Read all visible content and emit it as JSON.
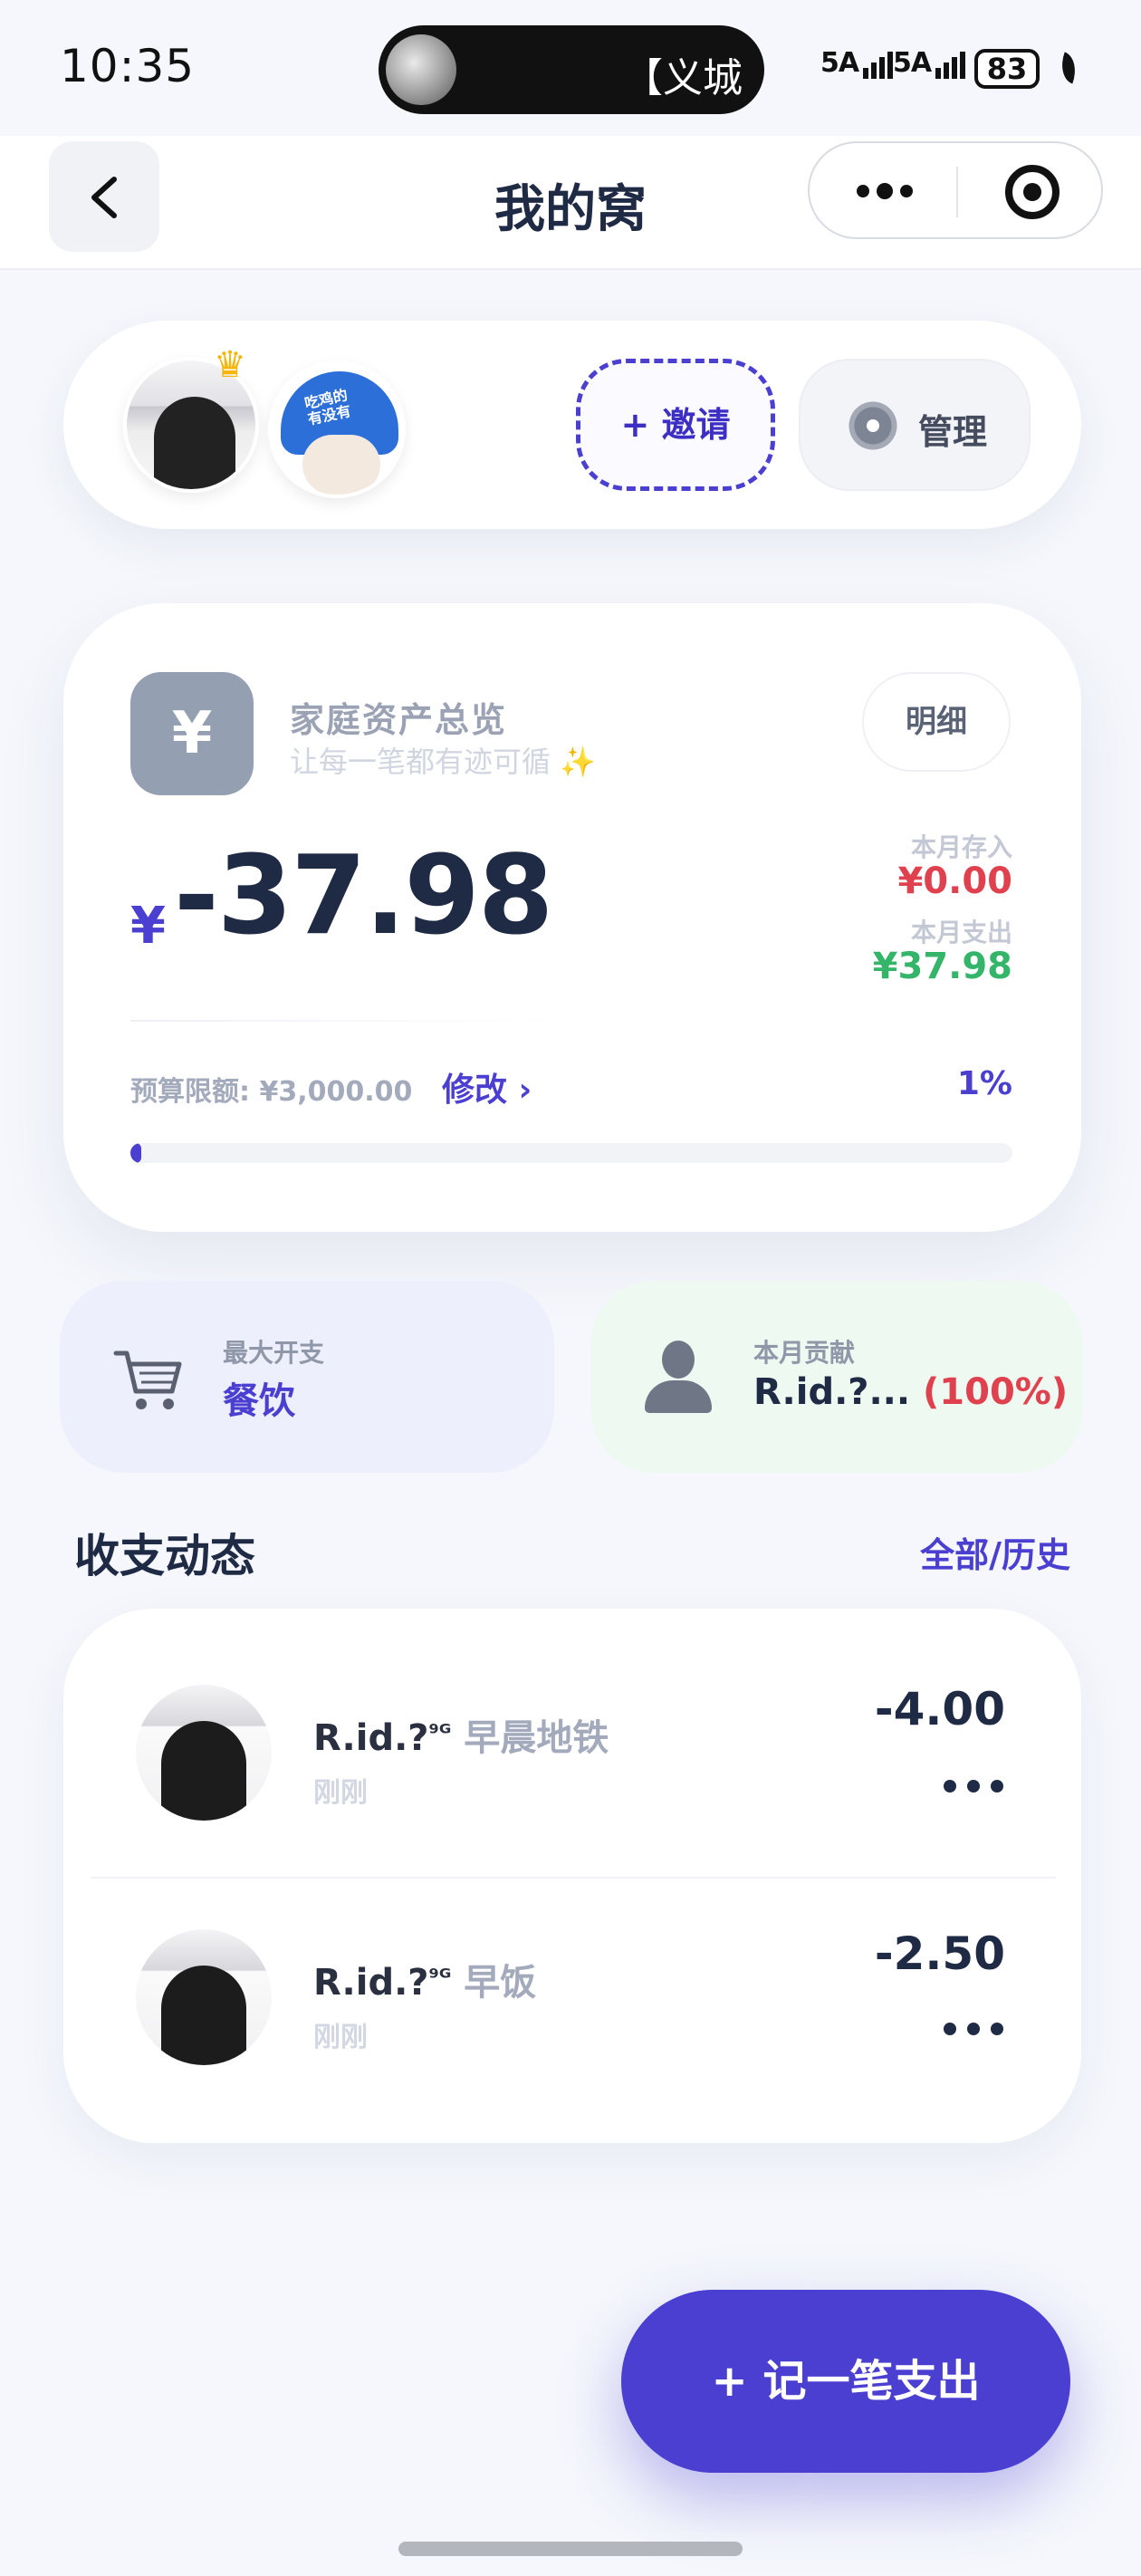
{
  "status_bar": {
    "time": "10:35",
    "island_text": "【义城",
    "signal1": "5A",
    "signal2": "5A",
    "battery": "83"
  },
  "nav": {
    "title": "我的窝"
  },
  "members": {
    "invite_label": "+ 邀请",
    "manage_label": "管理",
    "friend_helmet_text": "吃鸡的\n有没有"
  },
  "overview": {
    "title": "家庭资产总览",
    "subtitle": "让每一笔都有迹可循 ✨",
    "detail_label": "明细",
    "currency": "¥",
    "balance": "-37.98",
    "income_label": "本月存入",
    "income_value": "¥0.00",
    "expense_label": "本月支出",
    "expense_value": "¥37.98",
    "budget_label": "预算限额: ¥3,000.00",
    "edit_label": "修改 ›",
    "budget_percent_text": "1%",
    "budget_progress": 0.01
  },
  "stats": {
    "max_expense_label": "最大开支",
    "max_expense_value": "餐饮",
    "contribution_label": "本月贡献",
    "contribution_name": "R.id.?...",
    "contribution_pct": "(100%)"
  },
  "activity": {
    "title": "收支动态",
    "all_history_label": "全部/历史",
    "items": [
      {
        "name": "R.id.?",
        "name_suffix": "⁹ᴳ",
        "note": "早晨地铁",
        "time": "刚刚",
        "amount": "-4.00"
      },
      {
        "name": "R.id.?",
        "name_suffix": "⁹ᴳ",
        "note": "早饭",
        "time": "刚刚",
        "amount": "-2.50"
      }
    ]
  },
  "fab": {
    "label": "+ 记一笔支出"
  },
  "colors": {
    "accent": "#4a3fd1",
    "income": "#e0414f",
    "expense": "#35b56a",
    "contribution_pct": "#e0414f"
  }
}
